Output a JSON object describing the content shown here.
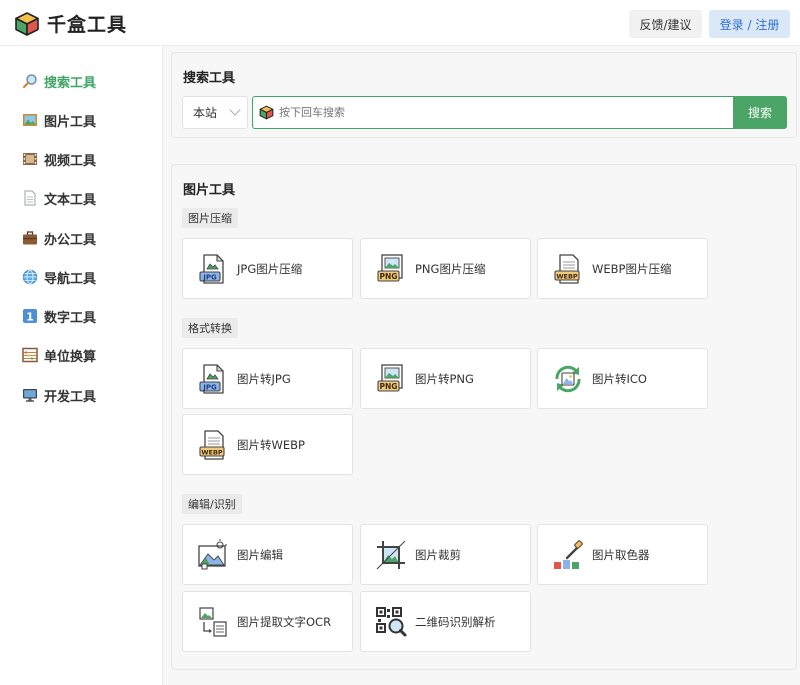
{
  "header": {
    "title": "千盒工具",
    "feedback_label": "反馈/建议",
    "login_label": "登录 / 注册"
  },
  "sidebar": {
    "items": [
      {
        "label": "搜索工具",
        "icon": "magnifier-icon",
        "active": true
      },
      {
        "label": "图片工具",
        "icon": "picture-icon"
      },
      {
        "label": "视频工具",
        "icon": "film-icon"
      },
      {
        "label": "文本工具",
        "icon": "document-icon"
      },
      {
        "label": "办公工具",
        "icon": "briefcase-icon"
      },
      {
        "label": "导航工具",
        "icon": "globe-icon"
      },
      {
        "label": "数字工具",
        "icon": "number-one-icon"
      },
      {
        "label": "单位换算",
        "icon": "abacus-icon"
      },
      {
        "label": "开发工具",
        "icon": "monitor-icon"
      }
    ]
  },
  "search": {
    "title": "搜索工具",
    "scope_value": "本站",
    "placeholder": "按下回车搜索",
    "button_label": "搜索"
  },
  "image_tools": {
    "title": "图片工具",
    "sections": [
      {
        "name": "图片压缩",
        "tools": [
          {
            "label": "JPG图片压缩",
            "icon": "jpg-file-icon"
          },
          {
            "label": "PNG图片压缩",
            "icon": "png-file-icon"
          },
          {
            "label": "WEBP图片压缩",
            "icon": "webp-file-icon"
          }
        ]
      },
      {
        "name": "格式转换",
        "tools": [
          {
            "label": "图片转JPG",
            "icon": "jpg-file-icon"
          },
          {
            "label": "图片转PNG",
            "icon": "png-file-icon"
          },
          {
            "label": "图片转ICO",
            "icon": "ico-convert-icon"
          },
          {
            "label": "图片转WEBP",
            "icon": "webp-file-icon"
          }
        ]
      },
      {
        "name": "编辑/识别",
        "tools": [
          {
            "label": "图片编辑",
            "icon": "image-edit-icon"
          },
          {
            "label": "图片裁剪",
            "icon": "crop-icon"
          },
          {
            "label": "图片取色器",
            "icon": "color-picker-icon"
          },
          {
            "label": "图片提取文字OCR",
            "icon": "ocr-icon"
          },
          {
            "label": "二维码识别解析",
            "icon": "qr-scan-icon"
          }
        ]
      }
    ]
  },
  "colors": {
    "accent": "#4aa566",
    "login_bg": "#dbe8f8",
    "login_text": "#2f6fd6"
  }
}
